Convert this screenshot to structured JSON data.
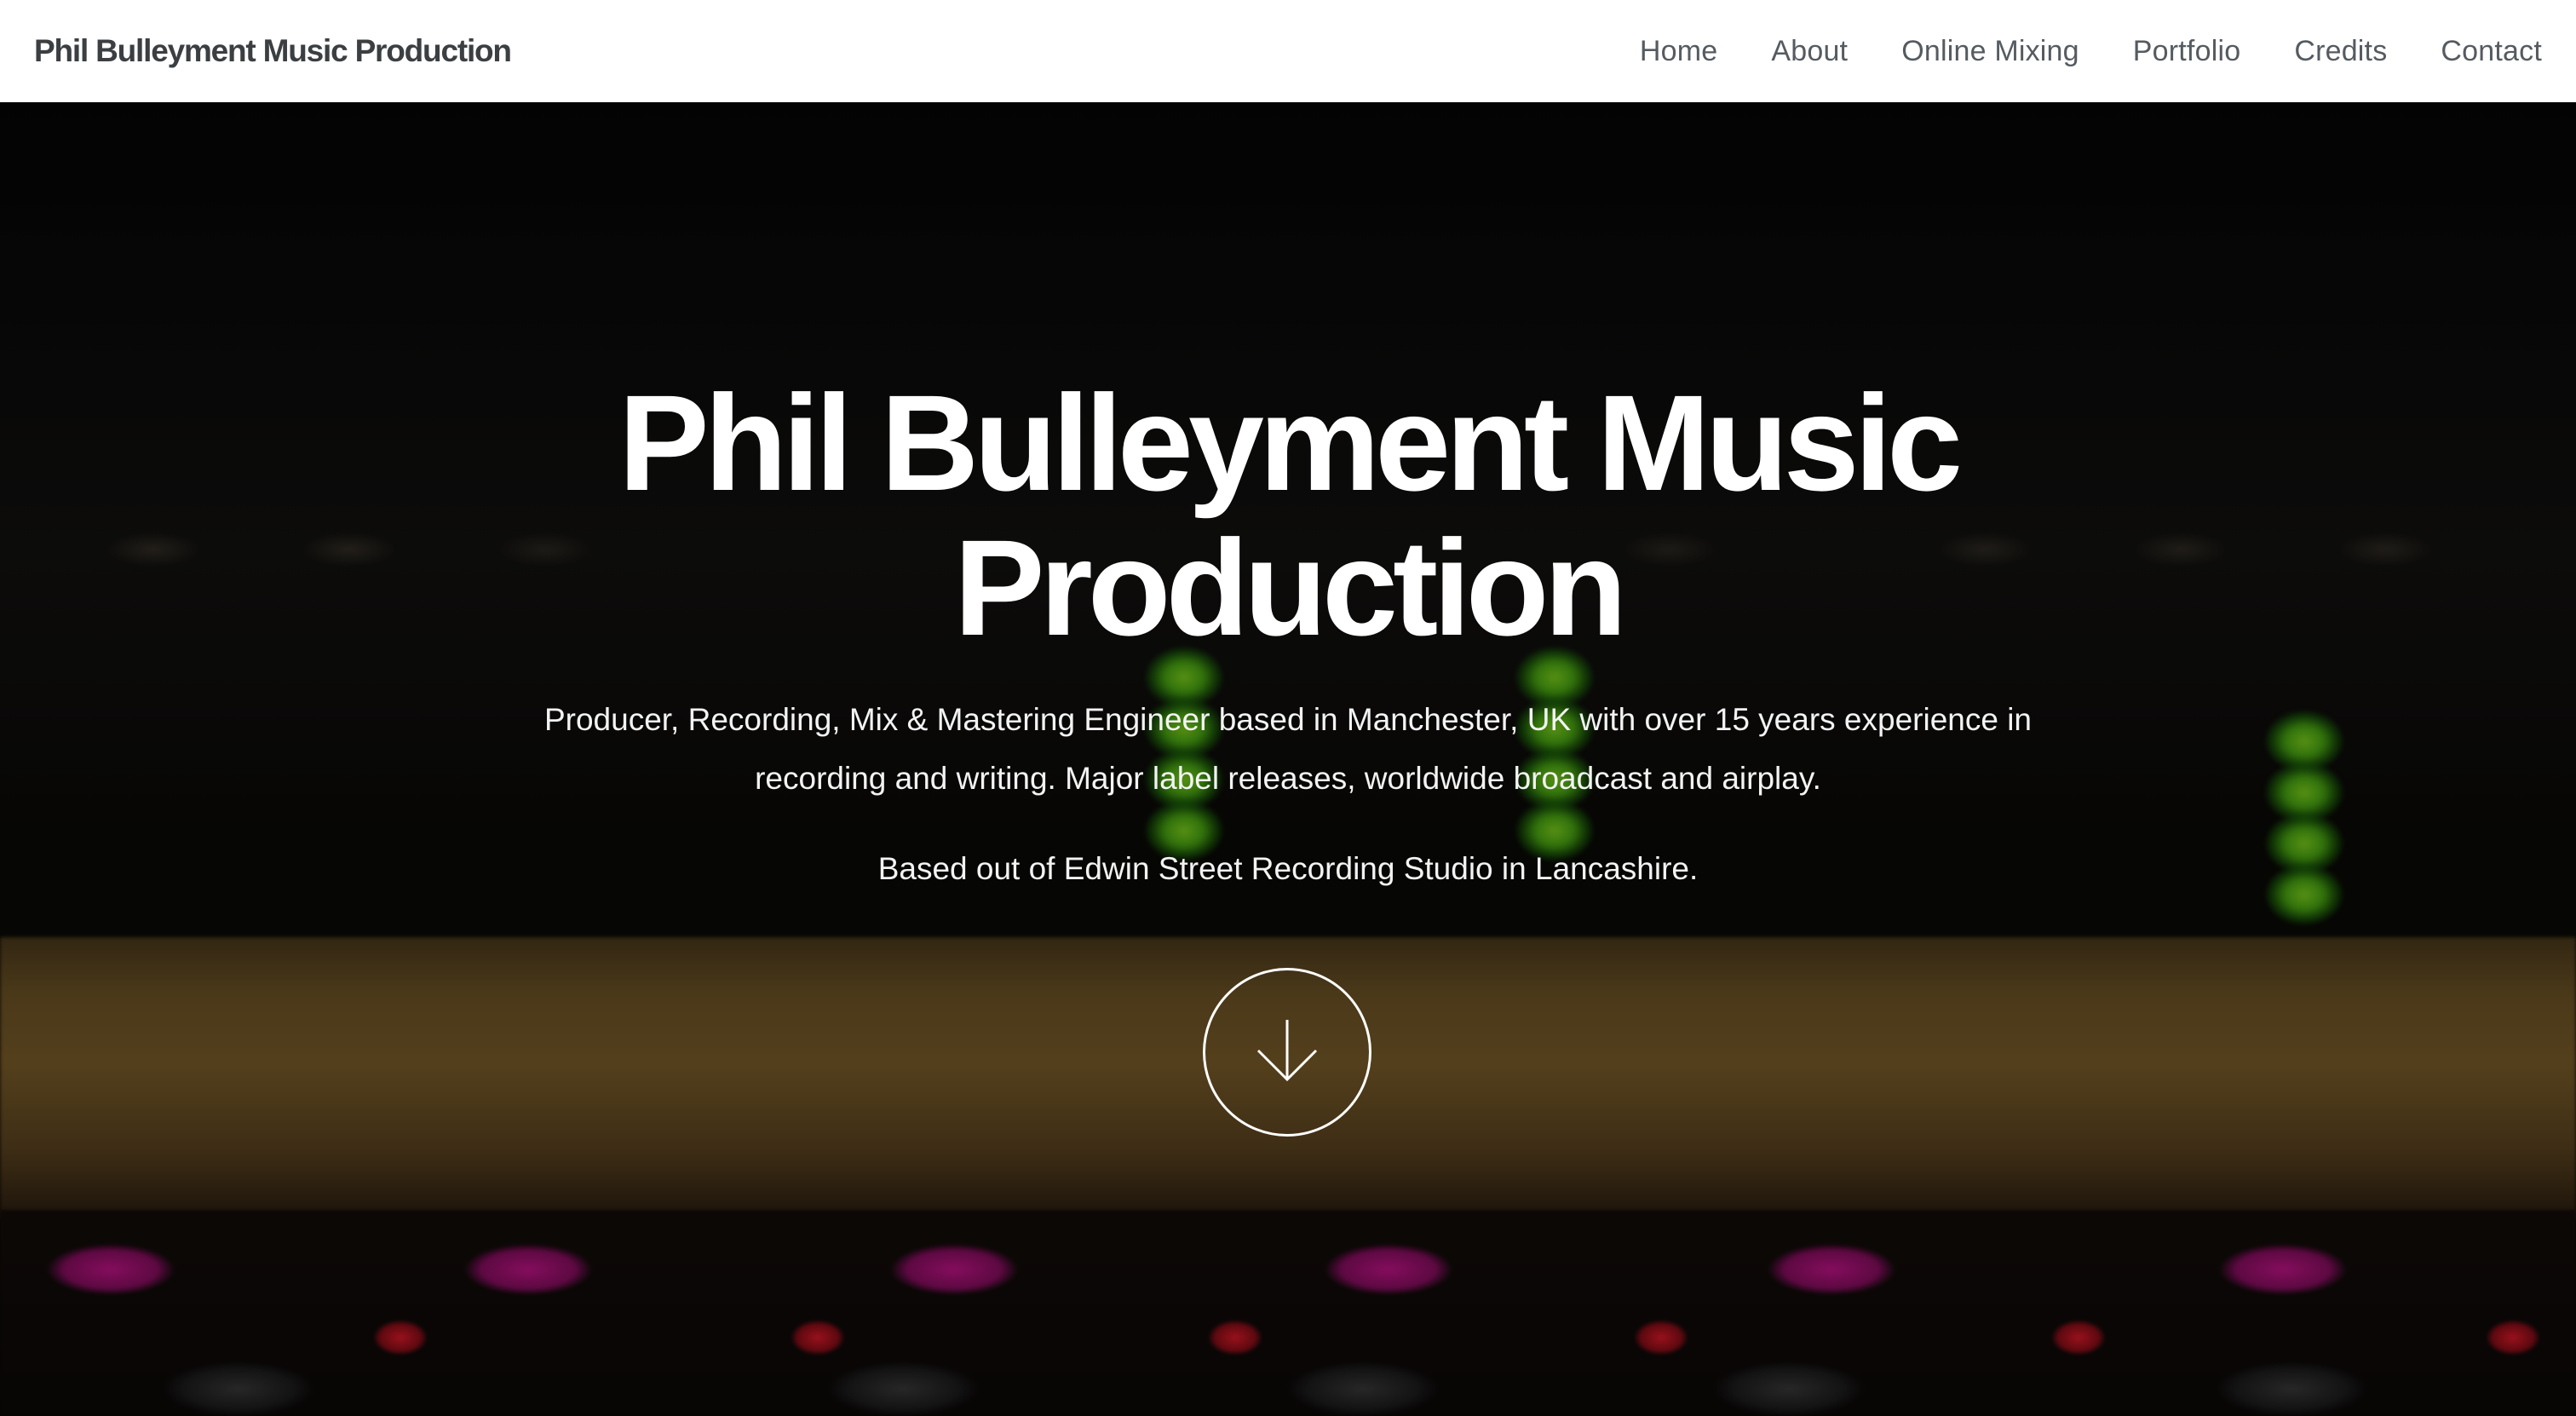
{
  "navbar": {
    "brand": "Phil Bulleyment Music Production",
    "items": [
      {
        "label": "Home"
      },
      {
        "label": "About"
      },
      {
        "label": "Online Mixing"
      },
      {
        "label": "Portfolio"
      },
      {
        "label": "Credits"
      },
      {
        "label": "Contact"
      }
    ]
  },
  "hero": {
    "title_line1": "Phil Bulleyment Music",
    "title_line2": "Production",
    "subtitle_line1": "Producer, Recording, Mix & Mastering Engineer based in Manchester, UK with over 15 years experience in",
    "subtitle_line2": "recording and writing. Major label releases, worldwide broadcast and airplay.",
    "location": "Based out of Edwin Street Recording Studio in Lancashire.",
    "scroll_icon": "arrow-down-icon"
  },
  "colors": {
    "navbar_bg": "#ffffff",
    "brand_text": "#3b3f42",
    "nav_text": "#555b60",
    "hero_text": "#ffffff"
  }
}
